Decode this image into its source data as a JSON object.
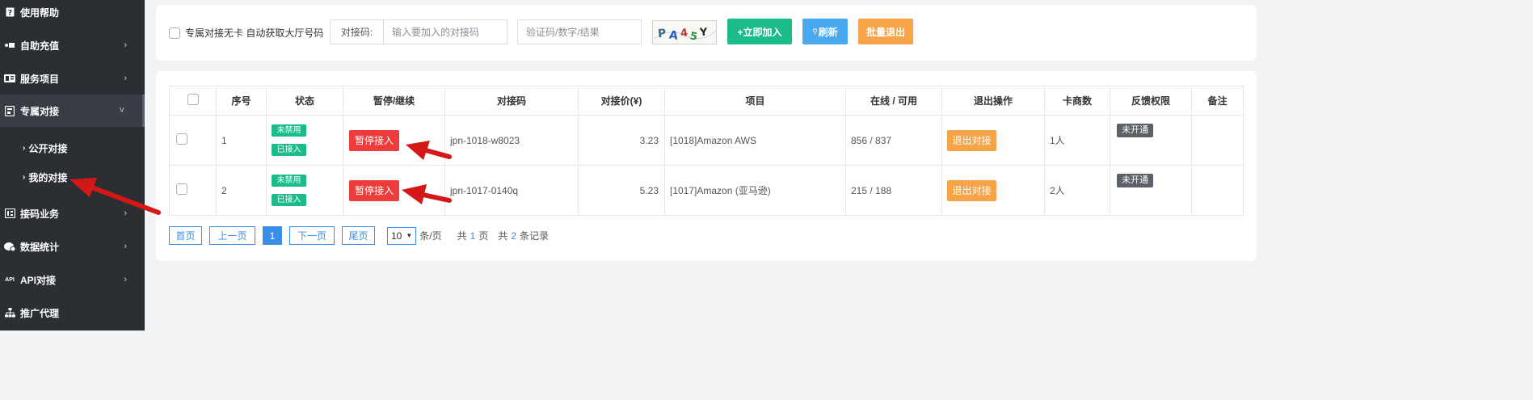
{
  "sidebar": {
    "items": [
      {
        "label": "使用帮助",
        "icon": "help-icon",
        "has_chevron": false
      },
      {
        "label": "自助充值",
        "icon": "recharge-icon",
        "has_chevron": true
      },
      {
        "label": "服务项目",
        "icon": "service-icon",
        "has_chevron": true
      },
      {
        "label": "专属对接",
        "icon": "dedicated-icon",
        "has_chevron": true,
        "expanded": true
      },
      {
        "label": "接码业务",
        "icon": "code-business-icon",
        "has_chevron": true
      },
      {
        "label": "数据统计",
        "icon": "stats-icon",
        "has_chevron": true
      },
      {
        "label": "API对接",
        "icon_text": "API",
        "has_chevron": true
      },
      {
        "label": "推广代理",
        "icon": "sitemap-icon",
        "has_chevron": false
      }
    ],
    "sub_items": [
      {
        "label": "公开对接"
      },
      {
        "label": "我的对接"
      }
    ],
    "chevron_right": "›",
    "chevron_down": "˅",
    "sub_caret": "›"
  },
  "toolbar": {
    "checkbox_label": "专属对接无卡 自动获取大厅号码",
    "code_label": "对接码:",
    "code_placeholder": "输入要加入的对接码",
    "captcha_placeholder": "验证码/数字/结果",
    "captcha_text": "PA45Y",
    "join_label": "+立即加入",
    "refresh_label": "刷新",
    "exit_all_label": "批量退出"
  },
  "table": {
    "headers": [
      "",
      "序号",
      "状态",
      "暂停/继续",
      "对接码",
      "对接价(¥)",
      "项目",
      "在线 / 可用",
      "退出操作",
      "卡商数",
      "反馈权限",
      "备注"
    ],
    "rows": [
      {
        "index": "1",
        "status1": "未禁用",
        "status2": "已接入",
        "pause_label": "暂停接入",
        "code": "jpn-1018-w8023",
        "price": "3.23",
        "project": "[1018]Amazon AWS",
        "online": "856 / 837",
        "exit_label": "退出对接",
        "vendors": "1人",
        "feedback": "未开通",
        "note": ""
      },
      {
        "index": "2",
        "status1": "未禁用",
        "status2": "已接入",
        "pause_label": "暂停接入",
        "code": "jpn-1017-0140q",
        "price": "5.23",
        "project": "[1017]Amazon (亚马逊)",
        "online": "215 / 188",
        "exit_label": "退出对接",
        "vendors": "2人",
        "feedback": "未开通",
        "note": ""
      }
    ]
  },
  "pager": {
    "first": "首页",
    "prev": "上一页",
    "current": "1",
    "next": "下一页",
    "last": "尾页",
    "page_size": "10",
    "per_page_suffix": "条/页",
    "total_pages_prefix": "共",
    "total_pages": "1",
    "total_pages_suffix": "页",
    "total_records_prefix": "共",
    "total_records": "2",
    "total_records_suffix": "条记录"
  },
  "colors": {
    "sidebar_bg": "#2b2e33",
    "green": "#1cbb8c",
    "blue": "#4aa8f0",
    "orange": "#f6a447",
    "red": "#ee3b3b",
    "arrow": "#d41818"
  }
}
